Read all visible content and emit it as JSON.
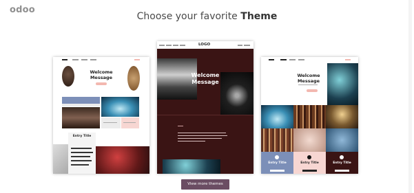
{
  "brand": {
    "logo_text": "odoo"
  },
  "header": {
    "title_prefix": "Choose your favorite",
    "title_strong": "Theme"
  },
  "themes": [
    {
      "welcome": "Welcome Message",
      "entry_title": "Entry Title"
    },
    {
      "logo": "LOGO",
      "welcome": "Welcome Message"
    },
    {
      "welcome": "Welcome Message",
      "entry_titles": [
        "Entry Title",
        "Entry Title",
        "Entry Title"
      ]
    }
  ],
  "actions": {
    "more_label": "View more themes"
  },
  "colors": {
    "brand": "#6b4d63",
    "theme2_bg": "#3a1414",
    "accent_pink": "#f3b8b0"
  }
}
